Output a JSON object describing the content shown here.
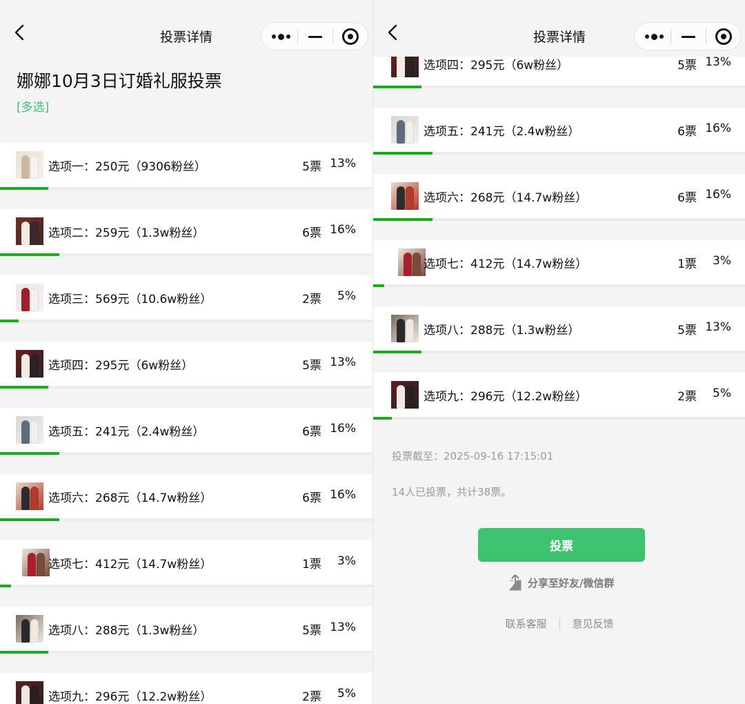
{
  "nav": {
    "title": "投票详情"
  },
  "poll": {
    "title": "娜娜10月3日订婚礼服投票",
    "type_tag": "[多选]",
    "deadline": "投票截至：2025-09-16 17:15:01",
    "summary": "14人已投票，共计38票。"
  },
  "options": [
    {
      "label": "选项一：250元（9306粉丝）",
      "votes": "5票",
      "percent": "13%",
      "share": 0.13,
      "thumb_colors": [
        "#e9e1d6",
        "#cbb8a2",
        "#f6f2ec"
      ]
    },
    {
      "label": "选项二：259元（1.3w粉丝）",
      "votes": "6票",
      "percent": "16%",
      "share": 0.16,
      "thumb_colors": [
        "#7a2a28",
        "#f1ebe3",
        "#3a2a2a"
      ]
    },
    {
      "label": "选项三：569元（10.6w粉丝）",
      "votes": "2票",
      "percent": "5%",
      "share": 0.05,
      "thumb_colors": [
        "#ece7e3",
        "#9e1f2c",
        "#f4f0ee"
      ]
    },
    {
      "label": "选项四：295元（6w粉丝）",
      "votes": "5票",
      "percent": "13%",
      "share": 0.13,
      "thumb_colors": [
        "#6a1e1e",
        "#f2ece4",
        "#2d2222"
      ]
    },
    {
      "label": "选项五：241元（2.4w粉丝）",
      "votes": "6票",
      "percent": "16%",
      "share": 0.16,
      "thumb_colors": [
        "#d9d7d4",
        "#5e6b7a",
        "#f1efec"
      ]
    },
    {
      "label": "选项六：268元（14.7w粉丝）",
      "votes": "6票",
      "percent": "16%",
      "share": 0.16,
      "thumb_colors": [
        "#e8d9c8",
        "#2c2c2c",
        "#b33a2f"
      ]
    },
    {
      "label": "选项七：412元（14.7w粉丝）",
      "votes": "1票",
      "percent": "3%",
      "share": 0.03,
      "thumb_colors": [
        "#efe6dc",
        "#a81f2d",
        "#7a4a3a"
      ]
    },
    {
      "label": "选项八：288元（1.3w粉丝）",
      "votes": "5票",
      "percent": "13%",
      "share": 0.13,
      "thumb_colors": [
        "#7a6c60",
        "#2a2a2a",
        "#efe9e2"
      ]
    },
    {
      "label": "选项九：296元（12.2w粉丝）",
      "votes": "2票",
      "percent": "5%",
      "share": 0.05,
      "thumb_colors": [
        "#5a1f22",
        "#f0e9e2",
        "#2a2020"
      ]
    }
  ],
  "actions": {
    "vote": "投票",
    "share": "分享至好友/微信群",
    "contact": "联系客服",
    "feedback": "意见反馈"
  },
  "icons": {
    "back": "chevron-left-icon",
    "more": "more-dots-icon",
    "minimize": "minus-icon",
    "close": "target-circle-icon",
    "share": "share-upload-icon"
  },
  "colors": {
    "accent": "#3dc26f",
    "progress": "#1aad19",
    "tag": "#3cc075"
  }
}
